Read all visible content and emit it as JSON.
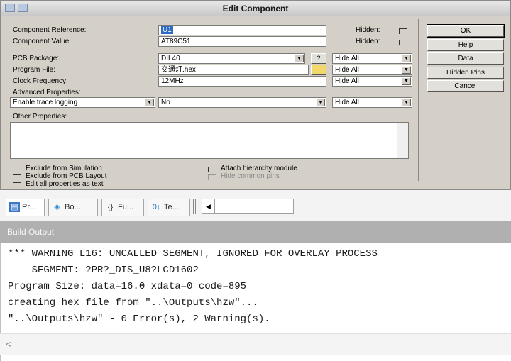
{
  "dialog": {
    "title": "Edit Component",
    "fields": {
      "reference_label": "Component Reference:",
      "reference_value": "U1",
      "value_label": "Component Value:",
      "value_value": "AT89C51",
      "hidden_label": "Hidden:",
      "pcb_label": "PCB Package:",
      "pcb_value": "DIL40",
      "pcb_help": "?",
      "program_label": "Program File:",
      "program_value": "交通灯.hex",
      "clock_label": "Clock Frequency:",
      "clock_value": "12MHz",
      "hide_all": "Hide All",
      "advanced_label": "Advanced Properties:",
      "advanced_prop": "Enable trace logging",
      "advanced_value": "No",
      "other_label": "Other Properties:"
    },
    "checkboxes": {
      "exclude_sim": "Exclude from Simulation",
      "exclude_pcb": "Exclude from PCB Layout",
      "edit_all": "Edit all properties as text",
      "attach_hier": "Attach hierarchy module",
      "hide_pins": "Hide common pins"
    },
    "buttons": {
      "ok": "OK",
      "help": "Help",
      "data": "Data",
      "hidden_pins": "Hidden Pins",
      "cancel": "Cancel"
    }
  },
  "tabs": [
    {
      "label": "Pr...",
      "icon": "project-icon"
    },
    {
      "label": "Bo...",
      "icon": "books-icon"
    },
    {
      "label": "Fu...",
      "icon": "functions-icon"
    },
    {
      "label": "Te...",
      "icon": "templates-icon"
    }
  ],
  "build": {
    "title": "Build Output",
    "lines": [
      "*** WARNING L16: UNCALLED SEGMENT, IGNORED FOR OVERLAY PROCESS",
      "    SEGMENT: ?PR?_DIS_U8?LCD1602",
      "Program Size: data=16.0 xdata=0 code=895",
      "creating hex file from \"..\\Outputs\\hzw\"...",
      "\"..\\Outputs\\hzw\" - 0 Error(s), 2 Warning(s)."
    ]
  },
  "colors": {
    "dialog_bg": "#d4d0c8",
    "build_header_bg": "#b0b0b0",
    "selection": "#316ac5"
  }
}
